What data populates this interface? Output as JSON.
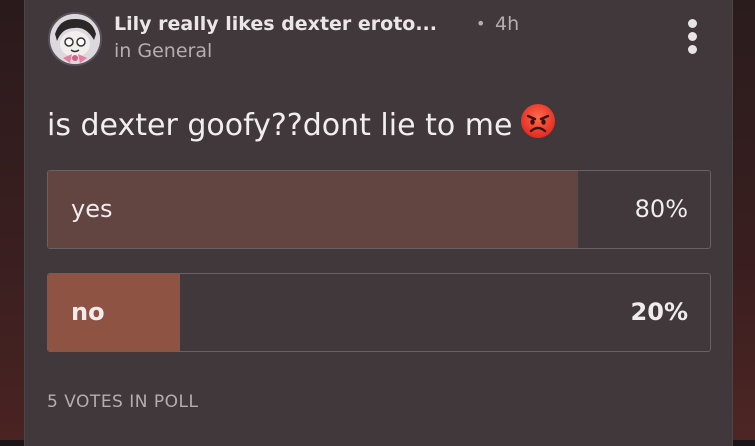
{
  "post": {
    "username": "Lily really likes dexter eroto...",
    "separator": "•",
    "time": "4h",
    "community": "in General",
    "question": "is dexter goofy??dont lie to me"
  },
  "poll": {
    "options": [
      {
        "label": "yes",
        "percent_text": "80%",
        "percent": 80,
        "fill_color": "#624440"
      },
      {
        "label": "no",
        "percent_text": "20%",
        "percent": 20,
        "fill_color": "#8e5343"
      }
    ],
    "votes_text": "5 VOTES IN POLL"
  },
  "icons": {
    "more": "more-vertical-icon",
    "emoji": "angry-face-emoji"
  }
}
